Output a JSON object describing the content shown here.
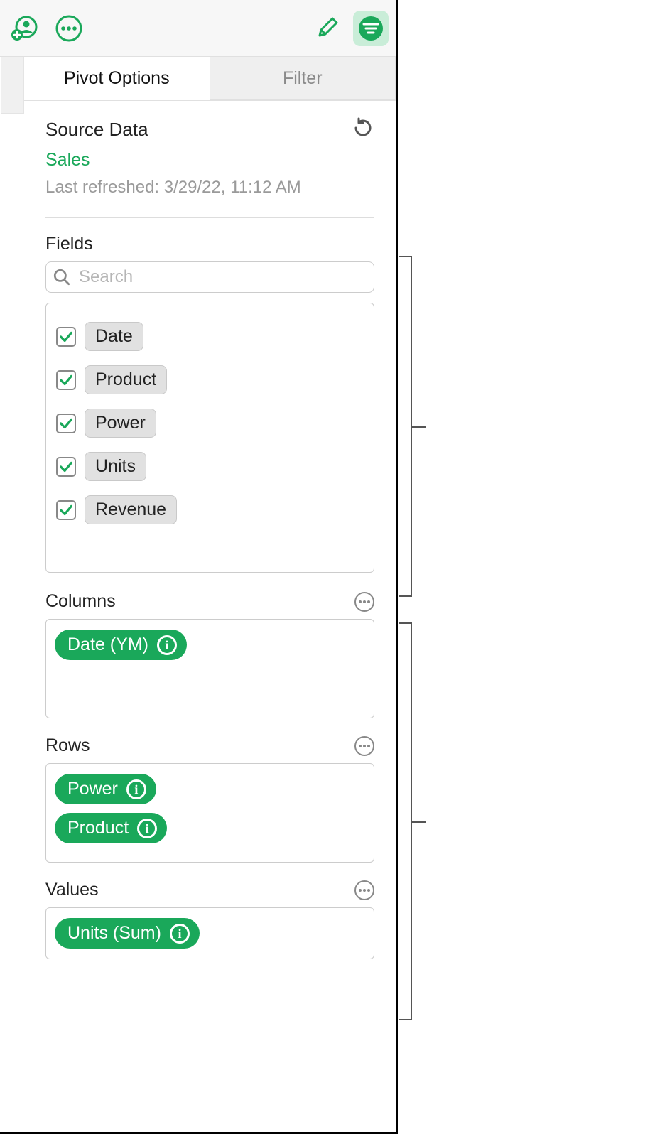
{
  "toolbar": {
    "icons": {
      "collaborate": "collaborate-icon",
      "more": "more-icon",
      "format": "format-brush-icon",
      "organize": "organize-icon"
    }
  },
  "tabs": {
    "pivot": "Pivot Options",
    "filter": "Filter"
  },
  "source": {
    "heading": "Source Data",
    "name": "Sales",
    "last_refreshed": "Last refreshed: 3/29/22, 11:12 AM"
  },
  "fields": {
    "heading": "Fields",
    "search_placeholder": "Search",
    "items": [
      {
        "label": "Date",
        "checked": true
      },
      {
        "label": "Product",
        "checked": true
      },
      {
        "label": "Power",
        "checked": true
      },
      {
        "label": "Units",
        "checked": true
      },
      {
        "label": "Revenue",
        "checked": true
      }
    ]
  },
  "columns": {
    "heading": "Columns",
    "items": [
      {
        "label": "Date (YM)"
      }
    ]
  },
  "rows": {
    "heading": "Rows",
    "items": [
      {
        "label": "Power"
      },
      {
        "label": "Product"
      }
    ]
  },
  "values": {
    "heading": "Values",
    "items": [
      {
        "label": "Units (Sum)"
      }
    ]
  },
  "colors": {
    "accent": "#1aa85a"
  }
}
